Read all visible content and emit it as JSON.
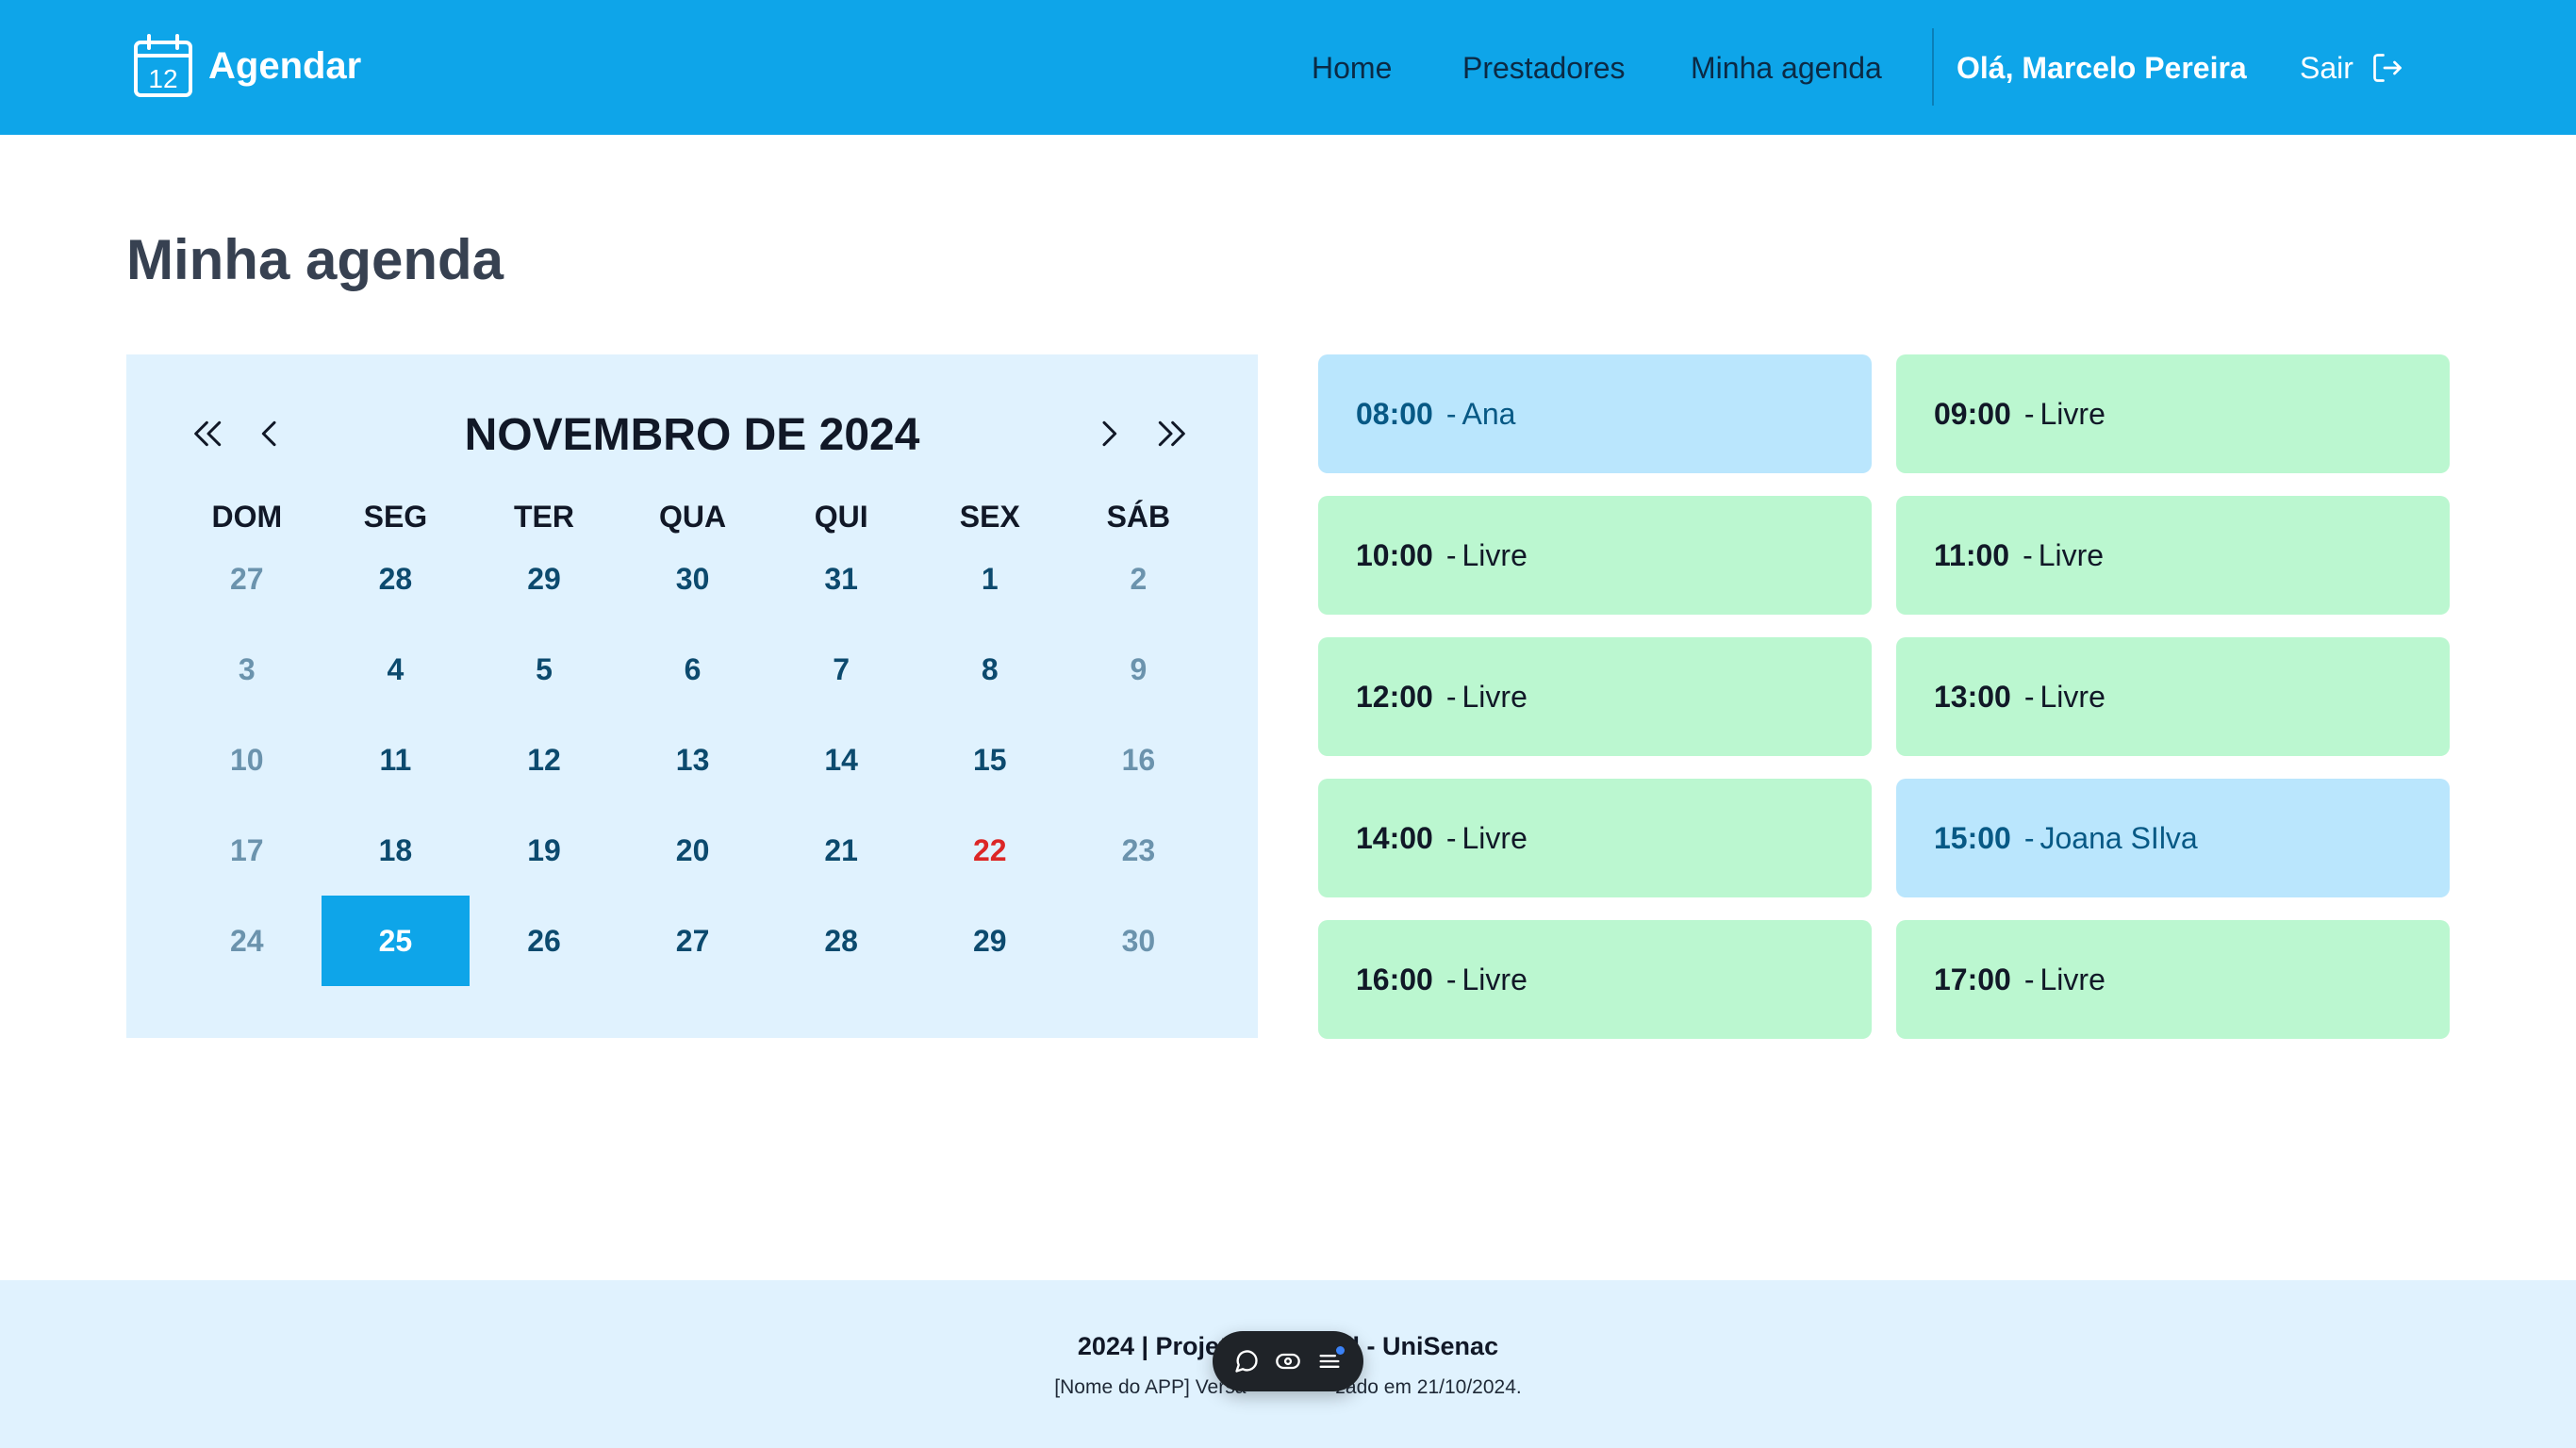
{
  "header": {
    "brand_name": "Agendar",
    "brand_icon_number": "12",
    "nav": [
      {
        "label": "Home",
        "icon": "none"
      },
      {
        "label": "Prestadores",
        "icon": "none"
      },
      {
        "label": "Minha agenda",
        "icon": "none"
      }
    ],
    "user_greeting": "Olá, Marcelo Pereira",
    "logout_label": "Sair",
    "logout_icon": "logout-icon"
  },
  "page": {
    "title": "Minha agenda"
  },
  "calendar": {
    "month_label": "NOVEMBRO DE 2024",
    "prev_year_icon": "double-chevron-left-icon",
    "prev_month_icon": "chevron-left-icon",
    "next_month_icon": "chevron-right-icon",
    "next_year_icon": "double-chevron-right-icon",
    "weekdays": [
      "DOM",
      "SEG",
      "TER",
      "QUA",
      "QUI",
      "SEX",
      "SÁB"
    ],
    "days": [
      {
        "label": "27",
        "state": "muted"
      },
      {
        "label": "28",
        "state": "normal"
      },
      {
        "label": "29",
        "state": "normal"
      },
      {
        "label": "30",
        "state": "normal"
      },
      {
        "label": "31",
        "state": "normal"
      },
      {
        "label": "1",
        "state": "normal"
      },
      {
        "label": "2",
        "state": "muted"
      },
      {
        "label": "3",
        "state": "muted"
      },
      {
        "label": "4",
        "state": "normal"
      },
      {
        "label": "5",
        "state": "normal"
      },
      {
        "label": "6",
        "state": "normal"
      },
      {
        "label": "7",
        "state": "normal"
      },
      {
        "label": "8",
        "state": "normal"
      },
      {
        "label": "9",
        "state": "muted"
      },
      {
        "label": "10",
        "state": "muted"
      },
      {
        "label": "11",
        "state": "normal"
      },
      {
        "label": "12",
        "state": "normal"
      },
      {
        "label": "13",
        "state": "normal"
      },
      {
        "label": "14",
        "state": "normal"
      },
      {
        "label": "15",
        "state": "normal"
      },
      {
        "label": "16",
        "state": "muted"
      },
      {
        "label": "17",
        "state": "muted"
      },
      {
        "label": "18",
        "state": "normal"
      },
      {
        "label": "19",
        "state": "normal"
      },
      {
        "label": "20",
        "state": "normal"
      },
      {
        "label": "21",
        "state": "normal"
      },
      {
        "label": "22",
        "state": "today"
      },
      {
        "label": "23",
        "state": "muted"
      },
      {
        "label": "24",
        "state": "muted"
      },
      {
        "label": "25",
        "state": "selected"
      },
      {
        "label": "26",
        "state": "normal"
      },
      {
        "label": "27",
        "state": "normal"
      },
      {
        "label": "28",
        "state": "normal"
      },
      {
        "label": "29",
        "state": "normal"
      },
      {
        "label": "30",
        "state": "muted"
      }
    ]
  },
  "slots": [
    {
      "time": "08:00",
      "label": "Ana",
      "status": "booked"
    },
    {
      "time": "09:00",
      "label": "Livre",
      "status": "free"
    },
    {
      "time": "10:00",
      "label": "Livre",
      "status": "free"
    },
    {
      "time": "11:00",
      "label": "Livre",
      "status": "free"
    },
    {
      "time": "12:00",
      "label": "Livre",
      "status": "free"
    },
    {
      "time": "13:00",
      "label": "Livre",
      "status": "free"
    },
    {
      "time": "14:00",
      "label": "Livre",
      "status": "free"
    },
    {
      "time": "15:00",
      "label": "Joana SIlva",
      "status": "booked"
    },
    {
      "time": "16:00",
      "label": "Livre",
      "status": "free"
    },
    {
      "time": "17:00",
      "label": "Livre",
      "status": "free"
    }
  ],
  "footer": {
    "line1_left": "2024 | Projet",
    "line1_right": "il - UniSenac",
    "line2_left": "[Nome do APP] Versã",
    "line2_right": "zado em 21/10/2024."
  },
  "floating_toolbar": {
    "icons": [
      "comment-icon",
      "eye-icon",
      "menu-icon"
    ]
  },
  "colors": {
    "header_bg": "#0ea5e9",
    "accent": "#0ea5e9",
    "calendar_bg": "#e0f2fe",
    "slot_free": "#bbf7d0",
    "slot_booked": "#bae6fd",
    "today": "#dc2626",
    "footer_bg": "#e0f2fe"
  }
}
